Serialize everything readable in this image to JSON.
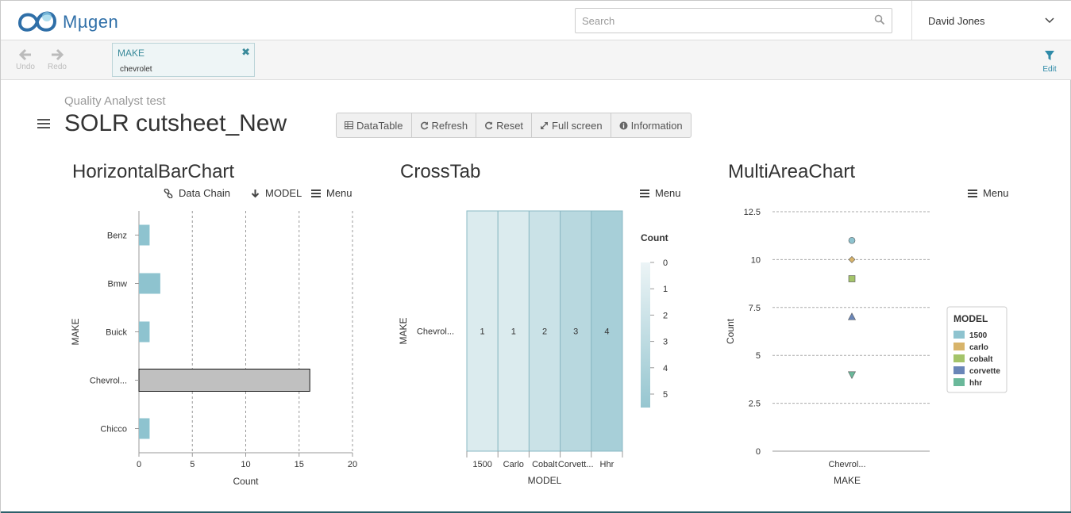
{
  "app": {
    "logo_text": "Mµgen"
  },
  "search": {
    "placeholder": "Search"
  },
  "user": {
    "name": "David Jones"
  },
  "toolbar": {
    "undo_label": "Undo",
    "redo_label": "Redo",
    "edit_label": "Edit"
  },
  "filter": {
    "title": "MAKE",
    "value": "chevrolet"
  },
  "page": {
    "subtitle": "Quality Analyst test",
    "title": "SOLR cutsheet_New",
    "buttons": {
      "datatable": "DataTable",
      "refresh": "Refresh",
      "reset": "Reset",
      "fullscreen": "Full screen",
      "information": "Information"
    }
  },
  "panels": {
    "hbar": {
      "title": "HorizontalBarChart",
      "data_chain": "Data Chain",
      "model": "MODEL",
      "menu": "Menu"
    },
    "crosstab": {
      "title": "CrossTab",
      "menu": "Menu"
    },
    "multiarea": {
      "title": "MultiAreaChart",
      "menu": "Menu"
    }
  },
  "colors": {
    "accent": "#2f8aa8",
    "bar": "#8ec3cf",
    "selected_bar": "#c0c0c0"
  },
  "chart_data": [
    {
      "type": "bar",
      "orientation": "horizontal",
      "categories": [
        "Benz",
        "Bmw",
        "Buick",
        "Chevrol...",
        "Chicco"
      ],
      "values": [
        1,
        2,
        1,
        16,
        1
      ],
      "selected_category": "Chevrol...",
      "xlabel": "Count",
      "ylabel": "MAKE",
      "xlim": [
        0,
        20
      ],
      "xticks": [
        "0",
        "5",
        "10",
        "15",
        "20"
      ],
      "grid": true
    },
    {
      "type": "heatmap",
      "rows": [
        "Chevrol..."
      ],
      "columns": [
        "1500",
        "Carlo",
        "Cobalt",
        "Corvett...",
        "Hhr"
      ],
      "values": [
        [
          1,
          1,
          2,
          3,
          4
        ]
      ],
      "xlabel": "MODEL",
      "ylabel": "MAKE",
      "legend_title": "Count",
      "legend_ticks": [
        "0",
        "1",
        "2",
        "3",
        "4",
        "5"
      ]
    },
    {
      "type": "scatter",
      "categories": [
        "Chevrol..."
      ],
      "series": [
        {
          "name": "1500",
          "values": [
            11
          ],
          "color": "#8ec3cf",
          "marker": "circle"
        },
        {
          "name": "carlo",
          "values": [
            10
          ],
          "color": "#d8b46a",
          "marker": "diamond"
        },
        {
          "name": "cobalt",
          "values": [
            9
          ],
          "color": "#a4c46a",
          "marker": "square"
        },
        {
          "name": "corvette",
          "values": [
            7
          ],
          "color": "#6a86b8",
          "marker": "triangle-up"
        },
        {
          "name": "hhr",
          "values": [
            4
          ],
          "color": "#6ab89a",
          "marker": "triangle-down"
        }
      ],
      "xlabel": "MAKE",
      "ylabel": "Count",
      "ylim": [
        0,
        12.5
      ],
      "yticks": [
        "0",
        "2.5",
        "5",
        "7.5",
        "10",
        "12.5"
      ],
      "legend_title": "MODEL",
      "legend_position": "right",
      "grid": true
    }
  ]
}
